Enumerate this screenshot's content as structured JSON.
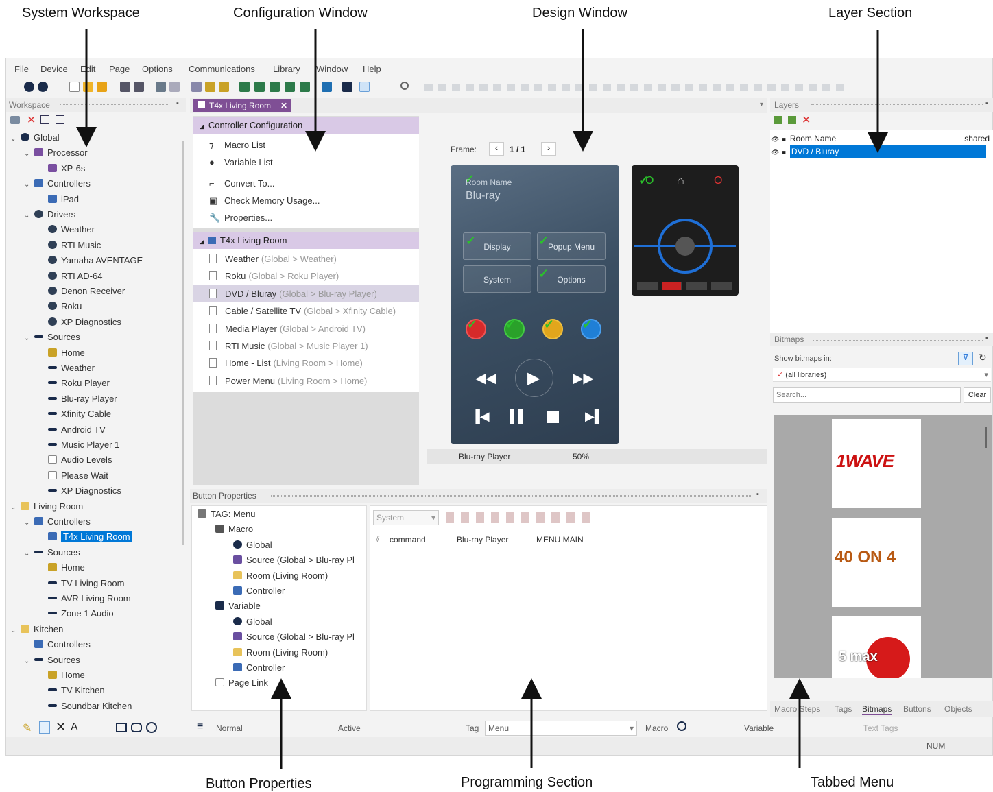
{
  "callouts": {
    "system_workspace": "System Workspace",
    "configuration_window": "Configuration Window",
    "design_window": "Design Window",
    "layer_section": "Layer Section",
    "button_properties": "Button Properties",
    "programming_section": "Programming Section",
    "tabbed_menu": "Tabbed Menu"
  },
  "menu": [
    "File",
    "Device",
    "Edit",
    "Page",
    "Options",
    "Communications",
    "Library",
    "Window",
    "Help"
  ],
  "workspace": {
    "title": "Workspace",
    "tree": [
      {
        "label": "Global",
        "level": 0,
        "icon": "globe-icon",
        "expanded": true
      },
      {
        "label": "Processor",
        "level": 1,
        "icon": "processor-icon",
        "expanded": true
      },
      {
        "label": "XP-6s",
        "level": 2,
        "icon": "processor-icon"
      },
      {
        "label": "Controllers",
        "level": 1,
        "icon": "controller-icon",
        "expanded": true
      },
      {
        "label": "iPad",
        "level": 2,
        "icon": "controller-icon"
      },
      {
        "label": "Drivers",
        "level": 1,
        "icon": "gear-icon",
        "expanded": true
      },
      {
        "label": "Weather",
        "level": 2,
        "icon": "gear-icon"
      },
      {
        "label": "RTI Music",
        "level": 2,
        "icon": "gear-icon"
      },
      {
        "label": "Yamaha AVENTAGE",
        "level": 2,
        "icon": "gear-icon"
      },
      {
        "label": "RTI AD-64",
        "level": 2,
        "icon": "gear-icon"
      },
      {
        "label": "Denon Receiver",
        "level": 2,
        "icon": "gear-icon"
      },
      {
        "label": "Roku",
        "level": 2,
        "icon": "gear-icon"
      },
      {
        "label": "XP Diagnostics",
        "level": 2,
        "icon": "gear-icon"
      },
      {
        "label": "Sources",
        "level": 1,
        "icon": "source-icon",
        "expanded": true
      },
      {
        "label": "Home",
        "level": 2,
        "icon": "home-icon"
      },
      {
        "label": "Weather",
        "level": 2,
        "icon": "source-icon"
      },
      {
        "label": "Roku Player",
        "level": 2,
        "icon": "source-icon"
      },
      {
        "label": "Blu-ray Player",
        "level": 2,
        "icon": "source-icon"
      },
      {
        "label": "Xfinity Cable",
        "level": 2,
        "icon": "source-icon"
      },
      {
        "label": "Android TV",
        "level": 2,
        "icon": "source-icon"
      },
      {
        "label": "Music Player 1",
        "level": 2,
        "icon": "source-icon"
      },
      {
        "label": "Audio Levels",
        "level": 2,
        "icon": "page-icon"
      },
      {
        "label": "Please Wait",
        "level": 2,
        "icon": "page-icon"
      },
      {
        "label": "XP Diagnostics",
        "level": 2,
        "icon": "source-icon"
      },
      {
        "label": "Living Room",
        "level": 0,
        "icon": "room-icon",
        "expanded": true
      },
      {
        "label": "Controllers",
        "level": 1,
        "icon": "controller-icon",
        "expanded": true
      },
      {
        "label": "T4x Living Room",
        "level": 2,
        "icon": "controller-icon",
        "selected": true
      },
      {
        "label": "Sources",
        "level": 1,
        "icon": "source-icon",
        "expanded": true
      },
      {
        "label": "Home",
        "level": 2,
        "icon": "home-icon"
      },
      {
        "label": "TV Living Room",
        "level": 2,
        "icon": "source-icon"
      },
      {
        "label": "AVR Living Room",
        "level": 2,
        "icon": "source-icon"
      },
      {
        "label": "Zone 1 Audio",
        "level": 2,
        "icon": "source-icon"
      },
      {
        "label": "Kitchen",
        "level": 0,
        "icon": "room-icon",
        "expanded": true
      },
      {
        "label": "Controllers",
        "level": 1,
        "icon": "controller-icon"
      },
      {
        "label": "Sources",
        "level": 1,
        "icon": "source-icon",
        "expanded": true
      },
      {
        "label": "Home",
        "level": 2,
        "icon": "home-icon"
      },
      {
        "label": "TV Kitchen",
        "level": 2,
        "icon": "source-icon"
      },
      {
        "label": "Soundbar Kitchen",
        "level": 2,
        "icon": "source-icon"
      }
    ]
  },
  "doc_tab": "T4x Living Room",
  "config": {
    "section1": "Controller Configuration",
    "items1": [
      "Macro List",
      "Variable List",
      "Convert To...",
      "Check Memory Usage...",
      "Properties..."
    ],
    "section2": "T4x Living Room",
    "pages": [
      {
        "name": "Weather",
        "path": "(Global > Weather)"
      },
      {
        "name": "Roku",
        "path": "(Global > Roku Player)"
      },
      {
        "name": "DVD / Bluray",
        "path": "(Global > Blu-ray Player)",
        "selected": true
      },
      {
        "name": "Cable / Satellite TV",
        "path": "(Global > Xfinity Cable)"
      },
      {
        "name": "Media Player",
        "path": "(Global > Android TV)"
      },
      {
        "name": "RTI Music",
        "path": "(Global > Music Player 1)"
      },
      {
        "name": "Home - List",
        "path": "(Living Room > Home)"
      },
      {
        "name": "Power Menu",
        "path": "(Living Room > Home)"
      }
    ]
  },
  "design": {
    "frame_label": "Frame:",
    "frame_value": "1 / 1",
    "remote_room_name": "Room Name",
    "remote_source": "Blu-ray",
    "buttons": [
      "Display",
      "Popup Menu",
      "System",
      "Options"
    ],
    "status_source": "Blu-ray Player",
    "status_zoom": "50%"
  },
  "layers": {
    "title": "Layers",
    "rows": [
      {
        "name": "Room Name",
        "tag": "shared"
      },
      {
        "name": "DVD / Bluray",
        "tag": "",
        "selected": true
      }
    ]
  },
  "bitmaps": {
    "title": "Bitmaps",
    "show_label": "Show bitmaps in:",
    "library": "(all libraries)",
    "search_placeholder": "Search...",
    "clear": "Clear",
    "images": [
      "1WAVE",
      "40 ON 4",
      "5 max"
    ]
  },
  "button_properties": {
    "title": "Button Properties",
    "tree": [
      {
        "label": "TAG: Menu",
        "level": 0
      },
      {
        "label": "Macro",
        "level": 1
      },
      {
        "label": "Global",
        "level": 2
      },
      {
        "label": "Source (Global > Blu-ray Pl",
        "level": 2
      },
      {
        "label": "Room (Living Room)",
        "level": 2
      },
      {
        "label": "Controller",
        "level": 2
      },
      {
        "label": "Variable",
        "level": 1
      },
      {
        "label": "Global",
        "level": 2
      },
      {
        "label": "Source (Global > Blu-ray Pl",
        "level": 2
      },
      {
        "label": "Room (Living Room)",
        "level": 2
      },
      {
        "label": "Controller",
        "level": 2
      },
      {
        "label": "Page Link",
        "level": 1
      }
    ]
  },
  "programming": {
    "system_select": "System",
    "command": "command",
    "device": "Blu-ray Player",
    "action": "MENU MAIN"
  },
  "tabs": [
    "Macro Steps",
    "Tags",
    "Bitmaps",
    "Buttons",
    "Objects"
  ],
  "bottom_toolbar": {
    "normal": "Normal",
    "active": "Active",
    "tag_label": "Tag",
    "tag_value": "Menu",
    "macro": "Macro",
    "variable": "Variable",
    "text_tags": "Text Tags"
  },
  "status": "NUM",
  "colors": {
    "accent": "#0078d7",
    "config_header": "#d9c9e6",
    "remote_bg": "#3d5166",
    "check_green": "#2bc22b"
  }
}
